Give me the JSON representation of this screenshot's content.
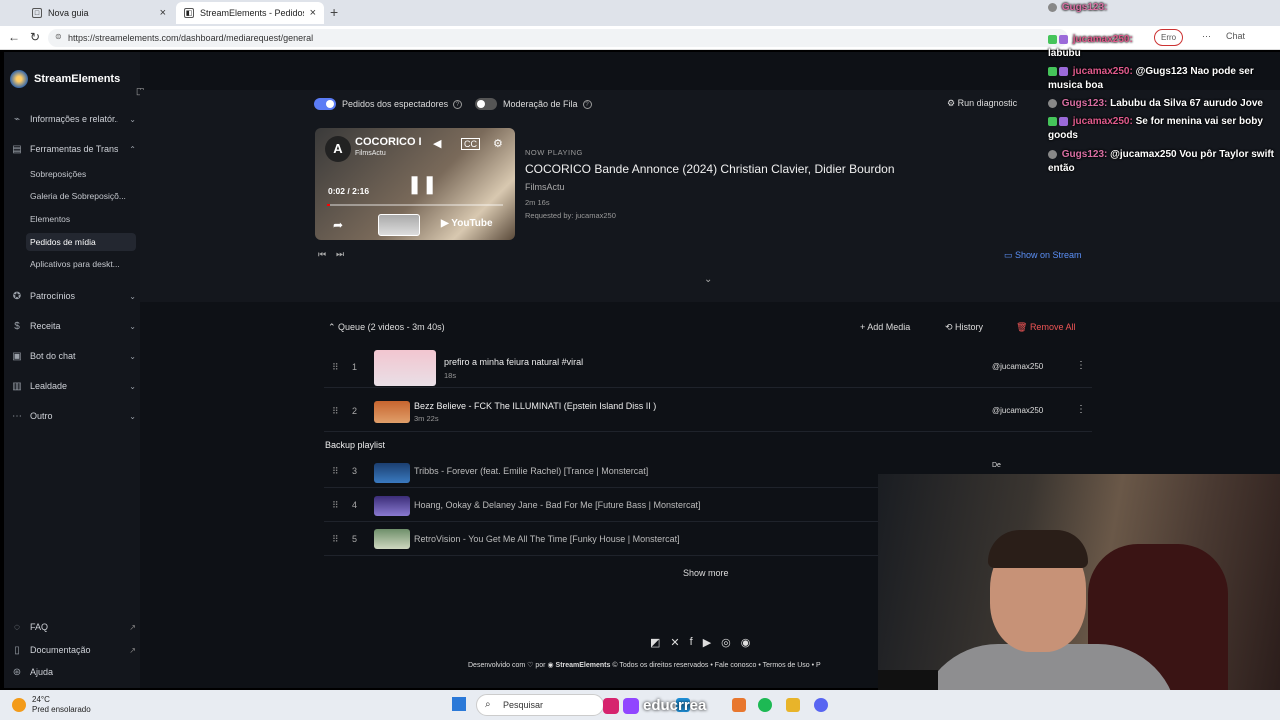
{
  "browser": {
    "tabs": [
      {
        "label": "Nova guia"
      },
      {
        "label": "StreamElements - Pedidos de..."
      }
    ],
    "url": "https://streamelements.com/dashboard/mediarequest/general",
    "chat_button": "Chat",
    "error_pill": "Erro"
  },
  "sidebar": {
    "brand": "StreamElements",
    "items": [
      {
        "label": "Informações e relatór..."
      },
      {
        "label": "Ferramentas de Trans..."
      },
      {
        "label": "Patrocínios"
      },
      {
        "label": "Receita"
      },
      {
        "label": "Bot do chat"
      },
      {
        "label": "Lealdade"
      },
      {
        "label": "Outro"
      }
    ],
    "subitems": [
      {
        "label": "Sobreposições"
      },
      {
        "label": "Galeria de Sobreposiçõ..."
      },
      {
        "label": "Elementos"
      },
      {
        "label": "Pedidos de mídia"
      },
      {
        "label": "Aplicativos para deskt..."
      }
    ],
    "bottom": [
      {
        "label": "FAQ"
      },
      {
        "label": "Documentação"
      },
      {
        "label": "Ajuda"
      }
    ]
  },
  "toggles": {
    "viewers": "Pedidos dos espectadores",
    "moderation": "Moderação de Fila",
    "diagnostic": "Run diagnostic"
  },
  "player": {
    "title": "COCORICO I",
    "channel": "FilmsActu",
    "time": "0:02 / 2:16",
    "progress": 0.015,
    "brand": "YouTube"
  },
  "now_playing": {
    "label": "NOW PLAYING",
    "title": "COCORICO Bande Annonce (2024) Christian Clavier, Didier Bourdon",
    "channel": "FilmsActu",
    "duration": "2m 16s",
    "requested": "Requested by: jucamax250",
    "show_on_stream": "Show on Stream"
  },
  "queue": {
    "header": "Queue (2 videos - 3m 40s)",
    "add_media": "Add Media",
    "history": "History",
    "remove_all": "Remove All",
    "items": [
      {
        "num": "1",
        "title": "prefiro a minha feiura natural #viral",
        "duration": "18s",
        "user": "@jucamax250"
      },
      {
        "num": "2",
        "title": "Bezz Believe - FCK The ILLUMINATI (Epstein Island Diss II )",
        "duration": "3m 22s",
        "user": "@jucamax250"
      }
    ],
    "backup_label": "Backup playlist",
    "backup": [
      {
        "num": "3",
        "title": "Tribbs - Forever (feat. Emilie Rachel) [Trance | Monstercat]",
        "user": "De"
      },
      {
        "num": "4",
        "title": "Hoang, Ookay & Delaney Jane - Bad For Me [Future Bass | Monstercat]"
      },
      {
        "num": "5",
        "title": "RetroVision - You Get Me All The Time [Funky House | Monstercat]"
      }
    ],
    "show_more": "Show more"
  },
  "footer": {
    "made_with": "Desenvolvido com",
    "by": "por",
    "brand": "StreamElements",
    "rights": "© Todos os direitos reservados",
    "contact": "• Fale conosco",
    "terms": "• Termos de Uso",
    "extra": "• P"
  },
  "chat": [
    {
      "name": "Gugs123:",
      "text": ""
    },
    {
      "name": "jucamax250:",
      "text": "labubu"
    },
    {
      "name": "jucamax250:",
      "text": "@Gugs123 Nao pode ser musica boa"
    },
    {
      "name": "Gugs123:",
      "text": "Labubu da Silva 67 aurudo Jove"
    },
    {
      "name": "jucamax250:",
      "text": "Se for menina vai ser boby goods"
    },
    {
      "name": "Gugs123:",
      "text": "@jucamax250 Vou pôr Taylor swift então"
    }
  ],
  "taskbar": {
    "temp": "24°C",
    "weather": "Pred ensolarado",
    "search": "Pesquisar",
    "watermark": "educrrea"
  },
  "colors": {
    "accent": "#5b7cf5",
    "danger": "#e55555",
    "chat_name": "#e05a8c"
  }
}
